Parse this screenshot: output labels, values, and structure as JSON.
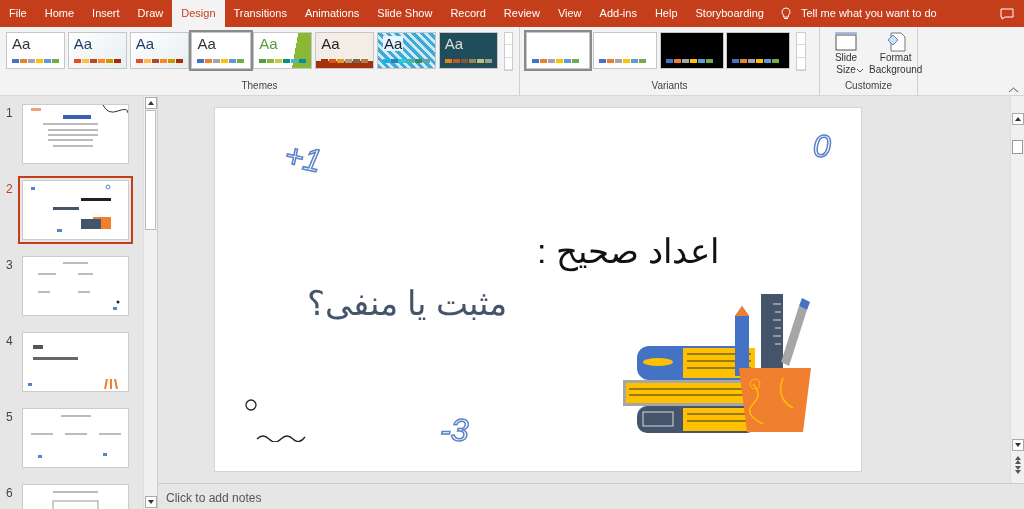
{
  "tabs": [
    {
      "label": "File",
      "selected": false
    },
    {
      "label": "Home",
      "selected": false
    },
    {
      "label": "Insert",
      "selected": false
    },
    {
      "label": "Draw",
      "selected": false
    },
    {
      "label": "Design",
      "selected": true
    },
    {
      "label": "Transitions",
      "selected": false
    },
    {
      "label": "Animations",
      "selected": false
    },
    {
      "label": "Slide Show",
      "selected": false
    },
    {
      "label": "Record",
      "selected": false
    },
    {
      "label": "Review",
      "selected": false
    },
    {
      "label": "View",
      "selected": false
    },
    {
      "label": "Add-ins",
      "selected": false
    },
    {
      "label": "Help",
      "selected": false
    },
    {
      "label": "Storyboarding",
      "selected": false
    }
  ],
  "tell_me": {
    "placeholder": "Tell me what you want to do"
  },
  "themes": {
    "label": "Themes",
    "items": [
      {
        "label": "Aa",
        "kind": "plain",
        "selected": false
      },
      {
        "label": "Aa",
        "kind": "mist",
        "selected": false
      },
      {
        "label": "Aa",
        "kind": "mist",
        "selected": false
      },
      {
        "label": "Aa",
        "kind": "plain",
        "selected": true
      },
      {
        "label": "Aa",
        "kind": "green",
        "selected": false
      },
      {
        "label": "Aa",
        "kind": "beige",
        "selected": false
      },
      {
        "label": "Aa",
        "kind": "pattern",
        "selected": false
      },
      {
        "label": "Aa",
        "kind": "teal",
        "selected": false
      }
    ]
  },
  "variants": {
    "label": "Variants",
    "items": [
      {
        "kind": "light",
        "selected": true
      },
      {
        "kind": "light",
        "selected": false
      },
      {
        "kind": "dark",
        "selected": false
      },
      {
        "kind": "dark",
        "selected": false
      }
    ]
  },
  "customize": {
    "label": "Customize",
    "buttons": [
      {
        "label": "Slide Size",
        "kind": "size"
      },
      {
        "label": "Format Background",
        "kind": "background"
      }
    ]
  },
  "slides": [
    {
      "number": "1",
      "kind": "wordart",
      "selected": false
    },
    {
      "number": "2",
      "kind": "title",
      "selected": true
    },
    {
      "number": "3",
      "kind": "list",
      "selected": false
    },
    {
      "number": "4",
      "kind": "section",
      "selected": false
    },
    {
      "number": "5",
      "kind": "columns",
      "selected": false
    },
    {
      "number": "6",
      "kind": "table",
      "selected": false
    }
  ],
  "slide": {
    "title": "اعداد صحیح :",
    "subtitle": "مثبت یا منفی؟",
    "numbers": [
      "+1",
      "0",
      "-3"
    ]
  },
  "notes": {
    "placeholder": "Click to add notes"
  }
}
